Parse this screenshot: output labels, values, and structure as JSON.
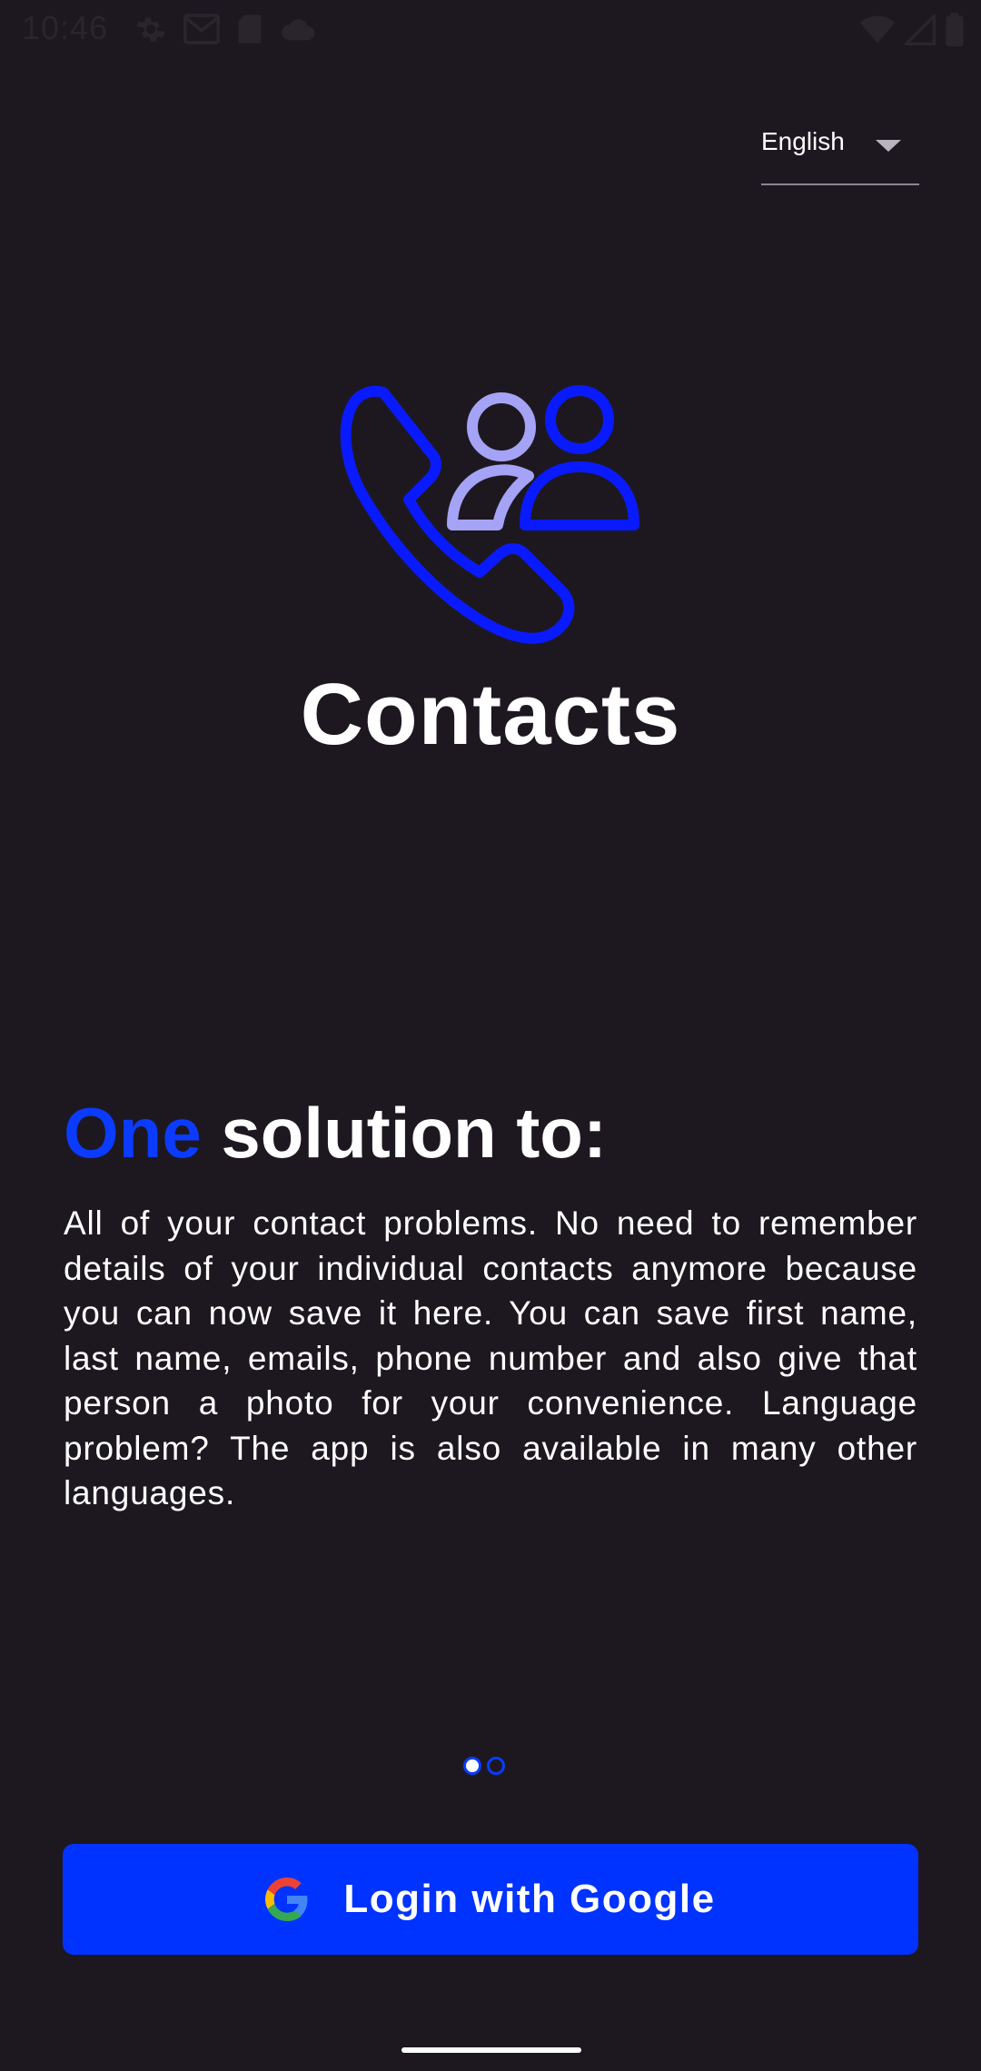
{
  "status_bar": {
    "time": "10:46",
    "left_icons": [
      "settings-icon",
      "gmail-icon",
      "sd-card-icon",
      "cloud-icon"
    ],
    "right_icons": [
      "wifi-icon",
      "cell-signal-icon",
      "battery-icon"
    ]
  },
  "language_selector": {
    "selected": "English"
  },
  "app": {
    "title": "Contacts",
    "logo_icon": "contacts-phone-people-icon"
  },
  "onboarding": {
    "headline_accent": "One",
    "headline_rest": " solution to:",
    "description": "All of your contact problems. No need to remember details of your individual contacts anymore because you can now save it here. You can save first name, last name, emails, phone number and also give that person a photo for your convenience. Language problem? The app is also available in many other languages.",
    "page_index": 1,
    "page_count": 2
  },
  "login": {
    "label": "Login with Google",
    "icon": "google-icon"
  },
  "colors": {
    "background": "#1d1820",
    "accent": "#0033ff",
    "accent_light": "#a5a3f5",
    "text": "#ffffff"
  }
}
